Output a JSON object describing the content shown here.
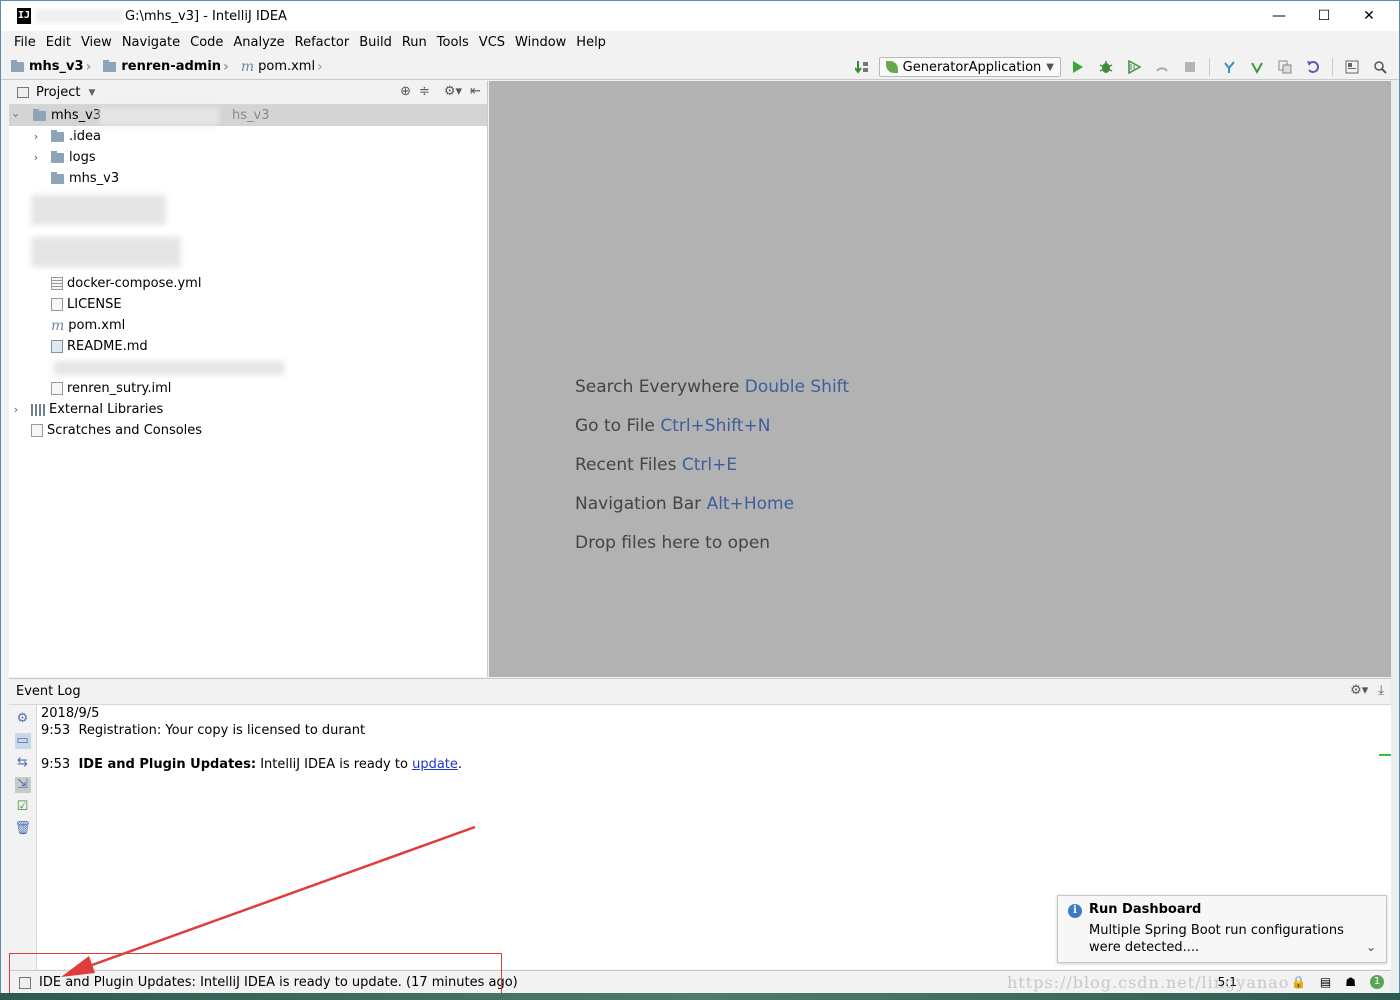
{
  "window": {
    "title": "G:\\mhs_v3] - IntelliJ IDEA",
    "app_icon_letter": "IJ",
    "minimize_glyph": "—",
    "maximize_glyph": "☐",
    "close_glyph": "✕"
  },
  "menu": [
    "File",
    "Edit",
    "View",
    "Navigate",
    "Code",
    "Analyze",
    "Refactor",
    "Build",
    "Run",
    "Tools",
    "VCS",
    "Window",
    "Help"
  ],
  "breadcrumbs": [
    "mhs_v3",
    "renren-admin",
    "pom.xml"
  ],
  "toolbar": {
    "run_config": "GeneratorApplication",
    "icons": [
      "build-icon",
      "run-icon",
      "debug-icon",
      "coverage-icon",
      "profile-icon",
      "stop-icon",
      "vcs-update-icon",
      "vcs-commit-icon",
      "vcs-compare-icon",
      "revert-icon",
      "project-structure-icon",
      "search-icon"
    ]
  },
  "project": {
    "header": "Project",
    "tree": [
      {
        "label": "mhs_v3",
        "extra": "hs_v3",
        "level": 0,
        "expanded": true,
        "type": "module"
      },
      {
        "label": ".idea",
        "level": 1,
        "expanded": false,
        "type": "folder"
      },
      {
        "label": "logs",
        "level": 1,
        "expanded": false,
        "type": "folder"
      },
      {
        "label": "mhs_v3",
        "level": 1,
        "type": "folder"
      },
      {
        "label": "docker-compose.yml",
        "level": 1,
        "type": "yml"
      },
      {
        "label": "LICENSE",
        "level": 1,
        "type": "file"
      },
      {
        "label": "pom.xml",
        "level": 1,
        "type": "maven"
      },
      {
        "label": "README.md",
        "level": 1,
        "type": "md"
      },
      {
        "label": "renren_sutry.iml",
        "level": 1,
        "type": "iml"
      },
      {
        "label": "External Libraries",
        "level": 0,
        "expanded": false,
        "type": "lib"
      },
      {
        "label": "Scratches and Consoles",
        "level": 0,
        "type": "scratch"
      }
    ]
  },
  "editor_hints": [
    {
      "text": "Search Everywhere",
      "key": "Double Shift"
    },
    {
      "text": "Go to File",
      "key": "Ctrl+Shift+N"
    },
    {
      "text": "Recent Files",
      "key": "Ctrl+E"
    },
    {
      "text": "Navigation Bar",
      "key": "Alt+Home"
    },
    {
      "text": "Drop files here to open",
      "key": ""
    }
  ],
  "event_log": {
    "title": "Event Log",
    "date": "2018/9/5",
    "entries": [
      {
        "time": "9:53",
        "title": "",
        "message": "Registration: Your copy is licensed to durant"
      },
      {
        "time": "9:53",
        "title": "IDE and Plugin Updates:",
        "message": "IntelliJ IDEA is ready to",
        "link": "update",
        "suffix": "."
      }
    ]
  },
  "notification": {
    "title": "Run Dashboard",
    "body": "Multiple Spring Boot run configurations were detected...."
  },
  "status": {
    "message": "IDE and Plugin Updates: IntelliJ IDEA is ready to update. (17 minutes ago)",
    "position": "5:1",
    "badge": "1"
  },
  "watermark": "https://blog.csdn.net/lingyanao"
}
